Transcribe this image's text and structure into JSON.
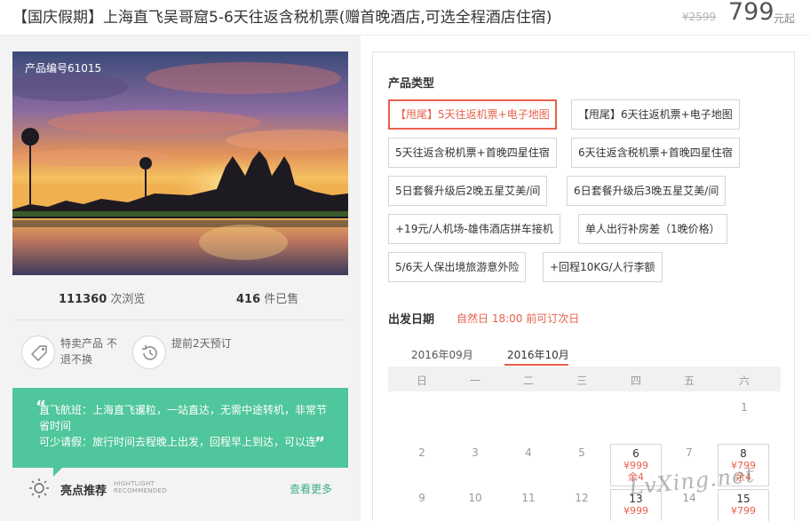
{
  "header": {
    "title": "【国庆假期】上海直飞吴哥窟5-6天往返含税机票(赠首晚酒店,可选全程酒店住宿)",
    "old_price": "¥2599",
    "price": "799",
    "price_suffix": "元起"
  },
  "product": {
    "code_label": "产品编号61015",
    "views_count": "111360",
    "views_label": "次浏览",
    "sold_count": "416",
    "sold_label": "件已售"
  },
  "features": [
    {
      "text": "特卖产品 不退不换",
      "icon": "tag-icon"
    },
    {
      "text": "提前2天预订",
      "icon": "clock-history-icon"
    }
  ],
  "highlight_box": {
    "quote_open": "“",
    "quote_close": "”",
    "line1": "直飞航班：上海直飞暹粒，一站直达，无需中途转机，非常节省时间",
    "line2": "可少请假：旅行时间去程晚上出发，回程早上到达，可以连"
  },
  "highlights": {
    "title": "亮点推荐",
    "subtitle_en_1": "HIGHTLIGHT",
    "subtitle_en_2": "RECOMMENDED",
    "more_label": "查看更多"
  },
  "product_type": {
    "label": "产品类型",
    "options": [
      {
        "label": "【甩尾】5天往返机票+电子地图",
        "selected": true
      },
      {
        "label": "【甩尾】6天往返机票+电子地图",
        "selected": false
      },
      {
        "label": "5天往返含税机票+首晚四星住宿",
        "selected": false
      },
      {
        "label": "6天往返含税机票+首晚四星住宿",
        "selected": false
      },
      {
        "label": "5日套餐升级后2晚五星艾美/间",
        "selected": false
      },
      {
        "label": "6日套餐升级后3晚五星艾美/间",
        "selected": false
      },
      {
        "label": "+19元/人机场-雄伟酒店拼车接机",
        "selected": false
      },
      {
        "label": "单人出行补房差（1晚价格）",
        "selected": false
      },
      {
        "label": "5/6天人保出境旅游意外险",
        "selected": false
      },
      {
        "label": "+回程10KG/人行李额",
        "selected": false
      }
    ]
  },
  "departure": {
    "label": "出发日期",
    "note": "自然日 18:00 前可订次日",
    "months": [
      "2016年09月",
      "2016年10月"
    ],
    "active_month": "2016年10月",
    "weekdays": [
      "日",
      "一",
      "二",
      "三",
      "四",
      "五",
      "六"
    ],
    "days": {
      "d1": "1",
      "d2": "2",
      "d3": "3",
      "d4": "4",
      "d5": "5",
      "d7": "7",
      "d9": "9",
      "d10": "10",
      "d11": "11",
      "d12": "12",
      "d14": "14"
    },
    "available": [
      {
        "day": "6",
        "price": "¥999",
        "stock": "余4"
      },
      {
        "day": "8",
        "price": "¥799",
        "stock": "余4"
      },
      {
        "day": "13",
        "price": "¥999",
        "stock": ""
      },
      {
        "day": "15",
        "price": "¥799",
        "stock": ""
      }
    ]
  },
  "watermark": "LvXing.net",
  "colors": {
    "accent": "#e8604c",
    "green": "#4fc69b",
    "link": "#3bb085"
  }
}
